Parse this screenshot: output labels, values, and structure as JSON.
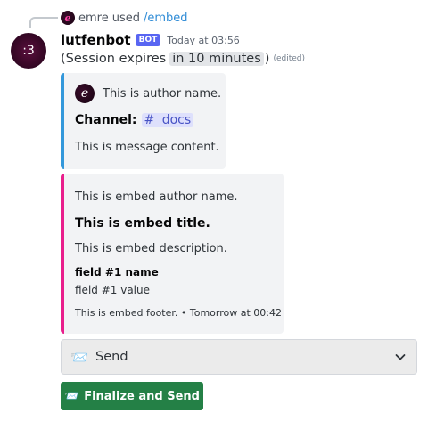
{
  "reply": {
    "user": "emre",
    "used_text": "used",
    "command": "/embed",
    "avatar_glyph": "e"
  },
  "message": {
    "avatar_text": ":3",
    "username": "lutfenbot",
    "bot_tag": "BOT",
    "timestamp": "Today at 03:56",
    "content_prefix": "(Session expires",
    "content_time": "in 10 minutes",
    "content_suffix": ")",
    "edited": "(edited)"
  },
  "embeds": [
    {
      "color": "#3498db",
      "author_name": "This is author name.",
      "author_avatar_glyph": "e",
      "title_label": "Channel:",
      "channel_icon": "#",
      "channel_name": "docs",
      "content": "This is message content."
    },
    {
      "color": "#e91e8c",
      "author_name": "This is embed author name.",
      "title": "This is embed title.",
      "description": "This is embed description.",
      "field_name": "field #1 name",
      "field_value": "field #1 value",
      "footer": "This is embed footer. • Tomorrow at 00:42"
    }
  ],
  "select": {
    "icon": "envelope-with-arrow-icon",
    "emoji": "📨",
    "label": "Send"
  },
  "button": {
    "icon": "envelope-icon",
    "emoji": "📨",
    "label": "Finalize and Send",
    "color": "#248046"
  }
}
